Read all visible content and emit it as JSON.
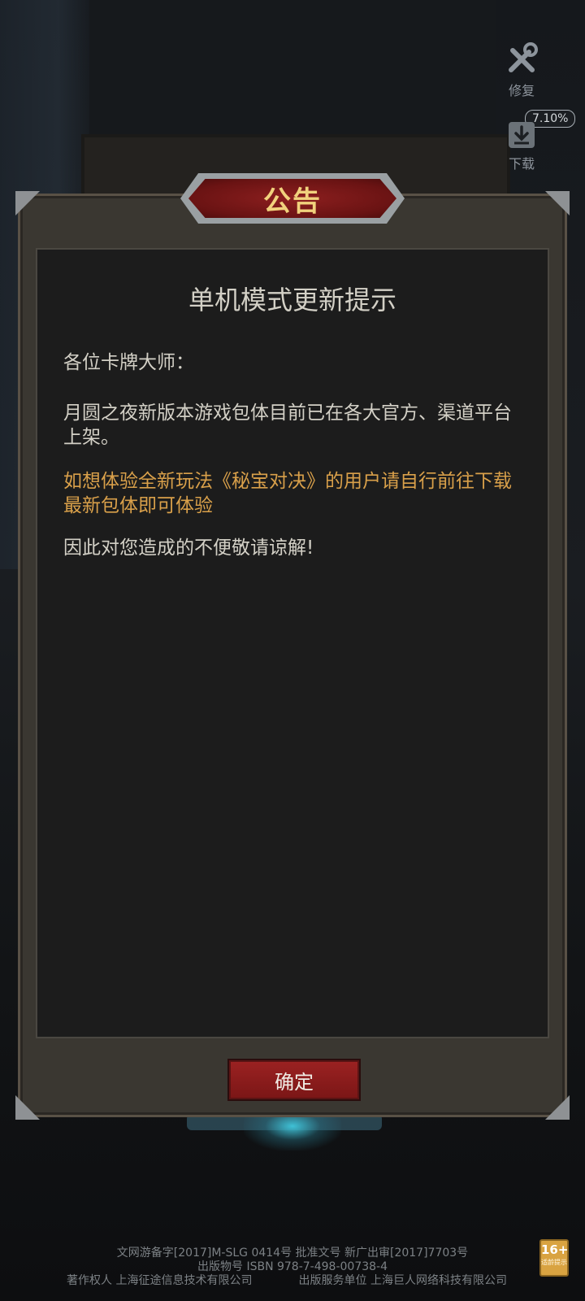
{
  "side_buttons": {
    "repair": {
      "label": "修复",
      "icon": "wrench-screwdriver-icon"
    },
    "download": {
      "label": "下载",
      "icon": "download-icon",
      "progress_text": "7.10%"
    }
  },
  "dialog": {
    "title": "公告",
    "heading": "单机模式更新提示",
    "greeting": "各位卡牌大师：",
    "release_text": "月圆之夜新版本游戏包体目前已在各大官方、渠道平台上架。",
    "highlight_text": "如想体验全新玩法《秘宝对决》的用户请自行前往下载最新包体即可体验",
    "apology_text": "因此对您造成的不便敬请谅解!",
    "confirm_label": "确定"
  },
  "footer": {
    "line1": "文网游备字[2017]M-SLG 0414号 批准文号 新广出审[2017]7703号",
    "line2": "出版物号 ISBN 978-7-498-00738-4",
    "copyright_owner": "著作权人 上海征途信息技术有限公司",
    "publisher": "出版服务单位 上海巨人网络科技有限公司"
  },
  "age_rating": {
    "label": "16+",
    "note": "适龄提示"
  },
  "colors": {
    "accent_gold": "#d9a04a",
    "title_gold": "#f1d27d",
    "button_red": "#9c2222"
  }
}
